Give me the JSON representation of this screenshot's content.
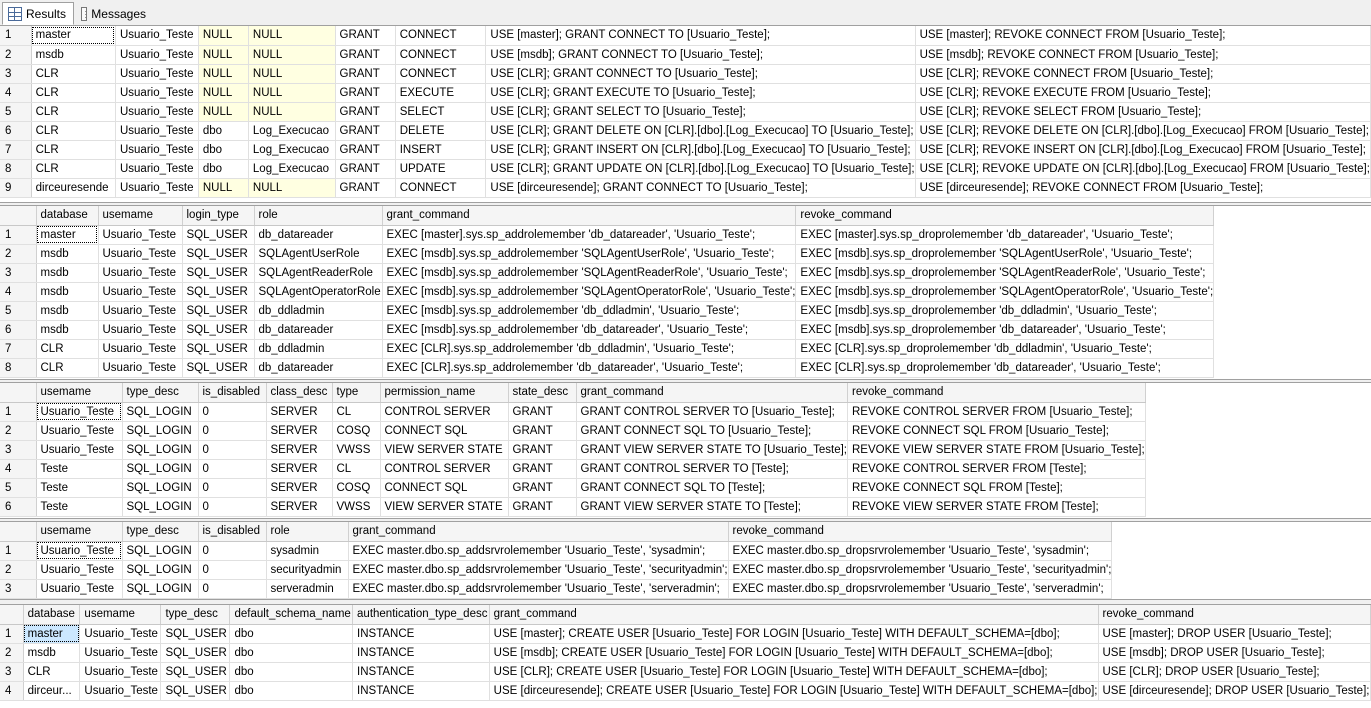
{
  "tabs": {
    "results": "Results",
    "messages": "Messages"
  },
  "grid1": {
    "rows": [
      [
        "1",
        "master",
        "Usuario_Teste",
        "NULL",
        "NULL",
        "GRANT",
        "CONNECT",
        "USE [master]; GRANT CONNECT TO [Usuario_Teste];",
        "USE [master]; REVOKE CONNECT FROM [Usuario_Teste];"
      ],
      [
        "2",
        "msdb",
        "Usuario_Teste",
        "NULL",
        "NULL",
        "GRANT",
        "CONNECT",
        "USE [msdb]; GRANT CONNECT TO [Usuario_Teste];",
        "USE [msdb]; REVOKE CONNECT FROM [Usuario_Teste];"
      ],
      [
        "3",
        "CLR",
        "Usuario_Teste",
        "NULL",
        "NULL",
        "GRANT",
        "CONNECT",
        "USE [CLR]; GRANT CONNECT TO [Usuario_Teste];",
        "USE [CLR]; REVOKE CONNECT FROM [Usuario_Teste];"
      ],
      [
        "4",
        "CLR",
        "Usuario_Teste",
        "NULL",
        "NULL",
        "GRANT",
        "EXECUTE",
        "USE [CLR]; GRANT EXECUTE TO [Usuario_Teste];",
        "USE [CLR]; REVOKE EXECUTE FROM [Usuario_Teste];"
      ],
      [
        "5",
        "CLR",
        "Usuario_Teste",
        "NULL",
        "NULL",
        "GRANT",
        "SELECT",
        "USE [CLR]; GRANT SELECT TO [Usuario_Teste];",
        "USE [CLR]; REVOKE SELECT FROM [Usuario_Teste];"
      ],
      [
        "6",
        "CLR",
        "Usuario_Teste",
        "dbo",
        "Log_Execucao",
        "GRANT",
        "DELETE",
        "USE [CLR]; GRANT DELETE ON [CLR].[dbo].[Log_Execucao] TO [Usuario_Teste];",
        "USE [CLR]; REVOKE DELETE ON [CLR].[dbo].[Log_Execucao] FROM [Usuario_Teste];"
      ],
      [
        "7",
        "CLR",
        "Usuario_Teste",
        "dbo",
        "Log_Execucao",
        "GRANT",
        "INSERT",
        "USE [CLR]; GRANT INSERT ON [CLR].[dbo].[Log_Execucao] TO [Usuario_Teste];",
        "USE [CLR]; REVOKE INSERT ON [CLR].[dbo].[Log_Execucao] FROM [Usuario_Teste];"
      ],
      [
        "8",
        "CLR",
        "Usuario_Teste",
        "dbo",
        "Log_Execucao",
        "GRANT",
        "UPDATE",
        "USE [CLR]; GRANT UPDATE ON [CLR].[dbo].[Log_Execucao] TO [Usuario_Teste];",
        "USE [CLR]; REVOKE UPDATE ON [CLR].[dbo].[Log_Execucao] FROM [Usuario_Teste];"
      ],
      [
        "9",
        "dirceuresende",
        "Usuario_Teste",
        "NULL",
        "NULL",
        "GRANT",
        "CONNECT",
        "USE [dirceuresende]; GRANT CONNECT TO [Usuario_Teste];",
        "USE [dirceuresende]; REVOKE CONNECT FROM [Usuario_Teste];"
      ]
    ]
  },
  "grid2": {
    "headers": [
      "",
      "database",
      "usemame",
      "login_type",
      "role",
      "grant_command",
      "revoke_command"
    ],
    "rows": [
      [
        "1",
        "master",
        "Usuario_Teste",
        "SQL_USER",
        "db_datareader",
        "EXEC [master].sys.sp_addrolemember 'db_datareader', 'Usuario_Teste';",
        "EXEC [master].sys.sp_droprolemember 'db_datareader', 'Usuario_Teste';"
      ],
      [
        "2",
        "msdb",
        "Usuario_Teste",
        "SQL_USER",
        "SQLAgentUserRole",
        "EXEC [msdb].sys.sp_addrolemember 'SQLAgentUserRole', 'Usuario_Teste';",
        "EXEC [msdb].sys.sp_droprolemember 'SQLAgentUserRole', 'Usuario_Teste';"
      ],
      [
        "3",
        "msdb",
        "Usuario_Teste",
        "SQL_USER",
        "SQLAgentReaderRole",
        "EXEC [msdb].sys.sp_addrolemember 'SQLAgentReaderRole', 'Usuario_Teste';",
        "EXEC [msdb].sys.sp_droprolemember 'SQLAgentReaderRole', 'Usuario_Teste';"
      ],
      [
        "4",
        "msdb",
        "Usuario_Teste",
        "SQL_USER",
        "SQLAgentOperatorRole",
        "EXEC [msdb].sys.sp_addrolemember 'SQLAgentOperatorRole', 'Usuario_Teste';",
        "EXEC [msdb].sys.sp_droprolemember 'SQLAgentOperatorRole', 'Usuario_Teste';"
      ],
      [
        "5",
        "msdb",
        "Usuario_Teste",
        "SQL_USER",
        "db_ddladmin",
        "EXEC [msdb].sys.sp_addrolemember 'db_ddladmin', 'Usuario_Teste';",
        "EXEC [msdb].sys.sp_droprolemember 'db_ddladmin', 'Usuario_Teste';"
      ],
      [
        "6",
        "msdb",
        "Usuario_Teste",
        "SQL_USER",
        "db_datareader",
        "EXEC [msdb].sys.sp_addrolemember 'db_datareader', 'Usuario_Teste';",
        "EXEC [msdb].sys.sp_droprolemember 'db_datareader', 'Usuario_Teste';"
      ],
      [
        "7",
        "CLR",
        "Usuario_Teste",
        "SQL_USER",
        "db_ddladmin",
        "EXEC [CLR].sys.sp_addrolemember 'db_ddladmin', 'Usuario_Teste';",
        "EXEC [CLR].sys.sp_droprolemember 'db_ddladmin', 'Usuario_Teste';"
      ],
      [
        "8",
        "CLR",
        "Usuario_Teste",
        "SQL_USER",
        "db_datareader",
        "EXEC [CLR].sys.sp_addrolemember 'db_datareader', 'Usuario_Teste';",
        "EXEC [CLR].sys.sp_droprolemember 'db_datareader', 'Usuario_Teste';"
      ]
    ]
  },
  "grid3": {
    "headers": [
      "",
      "usemame",
      "type_desc",
      "is_disabled",
      "class_desc",
      "type",
      "permission_name",
      "state_desc",
      "grant_command",
      "revoke_command"
    ],
    "rows": [
      [
        "1",
        "Usuario_Teste",
        "SQL_LOGIN",
        "0",
        "SERVER",
        "CL",
        "CONTROL SERVER",
        "GRANT",
        "GRANT CONTROL SERVER TO [Usuario_Teste];",
        "REVOKE CONTROL SERVER FROM [Usuario_Teste];"
      ],
      [
        "2",
        "Usuario_Teste",
        "SQL_LOGIN",
        "0",
        "SERVER",
        "COSQ",
        "CONNECT SQL",
        "GRANT",
        "GRANT CONNECT SQL TO [Usuario_Teste];",
        "REVOKE CONNECT SQL FROM [Usuario_Teste];"
      ],
      [
        "3",
        "Usuario_Teste",
        "SQL_LOGIN",
        "0",
        "SERVER",
        "VWSS",
        "VIEW SERVER STATE",
        "GRANT",
        "GRANT VIEW SERVER STATE TO [Usuario_Teste];",
        "REVOKE VIEW SERVER STATE FROM [Usuario_Teste];"
      ],
      [
        "4",
        "Teste",
        "SQL_LOGIN",
        "0",
        "SERVER",
        "CL",
        "CONTROL SERVER",
        "GRANT",
        "GRANT CONTROL SERVER TO [Teste];",
        "REVOKE CONTROL SERVER FROM [Teste];"
      ],
      [
        "5",
        "Teste",
        "SQL_LOGIN",
        "0",
        "SERVER",
        "COSQ",
        "CONNECT SQL",
        "GRANT",
        "GRANT CONNECT SQL TO [Teste];",
        "REVOKE CONNECT SQL FROM [Teste];"
      ],
      [
        "6",
        "Teste",
        "SQL_LOGIN",
        "0",
        "SERVER",
        "VWSS",
        "VIEW SERVER STATE",
        "GRANT",
        "GRANT VIEW SERVER STATE TO [Teste];",
        "REVOKE VIEW SERVER STATE FROM [Teste];"
      ]
    ]
  },
  "grid4": {
    "headers": [
      "",
      "usemame",
      "type_desc",
      "is_disabled",
      "role",
      "grant_command",
      "revoke_command"
    ],
    "rows": [
      [
        "1",
        "Usuario_Teste",
        "SQL_LOGIN",
        "0",
        "sysadmin",
        "EXEC master.dbo.sp_addsrvrolemember 'Usuario_Teste', 'sysadmin';",
        "EXEC master.dbo.sp_dropsrvrolemember 'Usuario_Teste', 'sysadmin';"
      ],
      [
        "2",
        "Usuario_Teste",
        "SQL_LOGIN",
        "0",
        "securityadmin",
        "EXEC master.dbo.sp_addsrvrolemember 'Usuario_Teste', 'securityadmin';",
        "EXEC master.dbo.sp_dropsrvrolemember 'Usuario_Teste', 'securityadmin';"
      ],
      [
        "3",
        "Usuario_Teste",
        "SQL_LOGIN",
        "0",
        "serveradmin",
        "EXEC master.dbo.sp_addsrvrolemember 'Usuario_Teste', 'serveradmin';",
        "EXEC master.dbo.sp_dropsrvrolemember 'Usuario_Teste', 'serveradmin';"
      ]
    ]
  },
  "grid5": {
    "headers": [
      "",
      "database",
      "usemame",
      "type_desc",
      "default_schema_name",
      "authentication_type_desc",
      "grant_command",
      "revoke_command"
    ],
    "rows": [
      [
        "1",
        "master",
        "Usuario_Teste",
        "SQL_USER",
        "dbo",
        "INSTANCE",
        "USE [master]; CREATE USER [Usuario_Teste] FOR LOGIN [Usuario_Teste] WITH DEFAULT_SCHEMA=[dbo];",
        "USE [master]; DROP USER [Usuario_Teste];"
      ],
      [
        "2",
        "msdb",
        "Usuario_Teste",
        "SQL_USER",
        "dbo",
        "INSTANCE",
        "USE [msdb]; CREATE USER [Usuario_Teste] FOR LOGIN [Usuario_Teste] WITH DEFAULT_SCHEMA=[dbo];",
        "USE [msdb]; DROP USER [Usuario_Teste];"
      ],
      [
        "3",
        "CLR",
        "Usuario_Teste",
        "SQL_USER",
        "dbo",
        "INSTANCE",
        "USE [CLR]; CREATE USER [Usuario_Teste] FOR LOGIN [Usuario_Teste] WITH DEFAULT_SCHEMA=[dbo];",
        "USE [CLR]; DROP USER [Usuario_Teste];"
      ],
      [
        "4",
        "dirceur...",
        "Usuario_Teste",
        "SQL_USER",
        "dbo",
        "INSTANCE",
        "USE [dirceuresende]; CREATE USER [Usuario_Teste] FOR LOGIN [Usuario_Teste] WITH DEFAULT_SCHEMA=[dbo];",
        "USE [dirceuresende]; DROP USER [Usuario_Teste];"
      ]
    ]
  }
}
